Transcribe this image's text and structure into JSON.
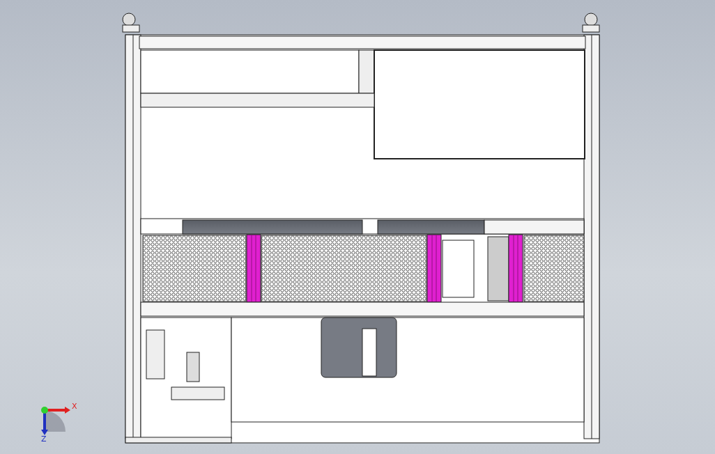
{
  "viewport": {
    "triad": {
      "x_label": "X",
      "z_label": "Z"
    }
  }
}
